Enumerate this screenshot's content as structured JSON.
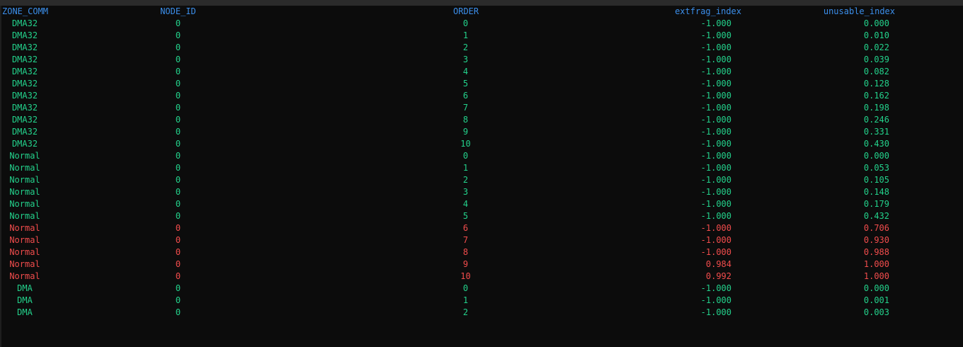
{
  "colors": {
    "background": "#0c0c0c",
    "header": "#3b8eea",
    "ok": "#23d18b",
    "bad": "#f14c4c"
  },
  "table": {
    "headers": {
      "zone": "ZONE_COMM",
      "node": "NODE_ID",
      "order": "ORDER",
      "extfrag": "extfrag_index",
      "unusable": "unusable_index"
    },
    "rows": [
      {
        "zone": "DMA32",
        "node": "0",
        "order": "0",
        "extfrag": "-1.000",
        "unusable": "0.000",
        "status": "ok"
      },
      {
        "zone": "DMA32",
        "node": "0",
        "order": "1",
        "extfrag": "-1.000",
        "unusable": "0.010",
        "status": "ok"
      },
      {
        "zone": "DMA32",
        "node": "0",
        "order": "2",
        "extfrag": "-1.000",
        "unusable": "0.022",
        "status": "ok"
      },
      {
        "zone": "DMA32",
        "node": "0",
        "order": "3",
        "extfrag": "-1.000",
        "unusable": "0.039",
        "status": "ok"
      },
      {
        "zone": "DMA32",
        "node": "0",
        "order": "4",
        "extfrag": "-1.000",
        "unusable": "0.082",
        "status": "ok"
      },
      {
        "zone": "DMA32",
        "node": "0",
        "order": "5",
        "extfrag": "-1.000",
        "unusable": "0.128",
        "status": "ok"
      },
      {
        "zone": "DMA32",
        "node": "0",
        "order": "6",
        "extfrag": "-1.000",
        "unusable": "0.162",
        "status": "ok"
      },
      {
        "zone": "DMA32",
        "node": "0",
        "order": "7",
        "extfrag": "-1.000",
        "unusable": "0.198",
        "status": "ok"
      },
      {
        "zone": "DMA32",
        "node": "0",
        "order": "8",
        "extfrag": "-1.000",
        "unusable": "0.246",
        "status": "ok"
      },
      {
        "zone": "DMA32",
        "node": "0",
        "order": "9",
        "extfrag": "-1.000",
        "unusable": "0.331",
        "status": "ok"
      },
      {
        "zone": "DMA32",
        "node": "0",
        "order": "10",
        "extfrag": "-1.000",
        "unusable": "0.430",
        "status": "ok"
      },
      {
        "zone": "Normal",
        "node": "0",
        "order": "0",
        "extfrag": "-1.000",
        "unusable": "0.000",
        "status": "ok"
      },
      {
        "zone": "Normal",
        "node": "0",
        "order": "1",
        "extfrag": "-1.000",
        "unusable": "0.053",
        "status": "ok"
      },
      {
        "zone": "Normal",
        "node": "0",
        "order": "2",
        "extfrag": "-1.000",
        "unusable": "0.105",
        "status": "ok"
      },
      {
        "zone": "Normal",
        "node": "0",
        "order": "3",
        "extfrag": "-1.000",
        "unusable": "0.148",
        "status": "ok"
      },
      {
        "zone": "Normal",
        "node": "0",
        "order": "4",
        "extfrag": "-1.000",
        "unusable": "0.179",
        "status": "ok"
      },
      {
        "zone": "Normal",
        "node": "0",
        "order": "5",
        "extfrag": "-1.000",
        "unusable": "0.432",
        "status": "ok"
      },
      {
        "zone": "Normal",
        "node": "0",
        "order": "6",
        "extfrag": "-1.000",
        "unusable": "0.706",
        "status": "bad"
      },
      {
        "zone": "Normal",
        "node": "0",
        "order": "7",
        "extfrag": "-1.000",
        "unusable": "0.930",
        "status": "bad"
      },
      {
        "zone": "Normal",
        "node": "0",
        "order": "8",
        "extfrag": "-1.000",
        "unusable": "0.988",
        "status": "bad"
      },
      {
        "zone": "Normal",
        "node": "0",
        "order": "9",
        "extfrag": "0.984",
        "unusable": "1.000",
        "status": "bad"
      },
      {
        "zone": "Normal",
        "node": "0",
        "order": "10",
        "extfrag": "0.992",
        "unusable": "1.000",
        "status": "bad"
      },
      {
        "zone": "DMA",
        "node": "0",
        "order": "0",
        "extfrag": "-1.000",
        "unusable": "0.000",
        "status": "ok"
      },
      {
        "zone": "DMA",
        "node": "0",
        "order": "1",
        "extfrag": "-1.000",
        "unusable": "0.001",
        "status": "ok"
      },
      {
        "zone": "DMA",
        "node": "0",
        "order": "2",
        "extfrag": "-1.000",
        "unusable": "0.003",
        "status": "ok"
      }
    ]
  }
}
